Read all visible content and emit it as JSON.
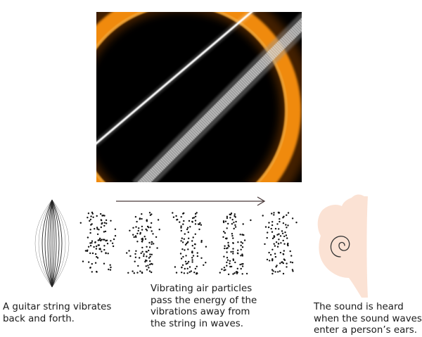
{
  "diagram": {
    "photo": {
      "icon": "guitar-string-closeup-photo",
      "colors": {
        "background": "#000000",
        "glow": "#f08a10",
        "string_bright": "#ffffff",
        "string_blur": "#9a9a9a"
      }
    },
    "arrow": {
      "icon": "right-arrow",
      "color": "#4a3a3a"
    },
    "string_figure": {
      "icon": "vibrating-string-icon",
      "color": "#222222"
    },
    "particles": {
      "icon": "air-particle-dots",
      "groups": 5,
      "color": "#111111"
    },
    "ear": {
      "icon": "ear-icon",
      "fill": "#fbe2d4",
      "stroke": "#333333"
    },
    "captions": {
      "string": [
        "A guitar string vibrates",
        "back and forth."
      ],
      "air": [
        "Vibrating air particles",
        "pass the energy of the",
        "vibrations away from",
        "the string in waves."
      ],
      "ear": [
        "The sound is heard",
        "when the sound waves",
        "enter a person’s ears."
      ]
    }
  }
}
